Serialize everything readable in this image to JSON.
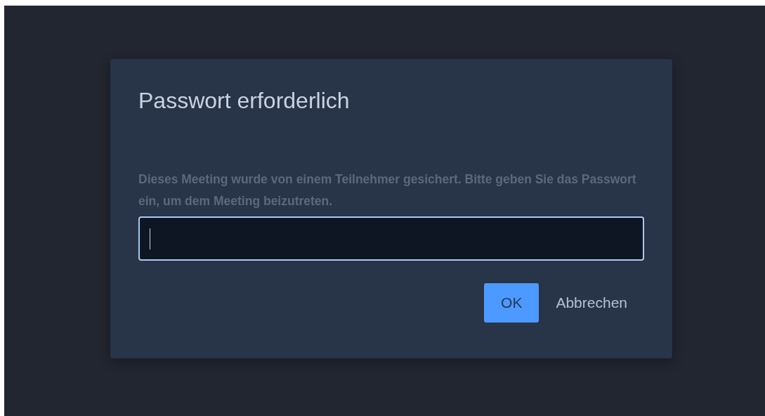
{
  "dialog": {
    "title": "Passwort erforderlich",
    "message": "Dieses Meeting wurde von einem Teilnehmer gesichert. Bitte geben Sie das Passwort ein, um dem Meeting beizutreten.",
    "password_field": {
      "focused": true
    },
    "buttons": [
      {
        "label": "OK",
        "kind": "primary"
      },
      {
        "label": "Abbrechen",
        "kind": "secondary"
      }
    ]
  }
}
